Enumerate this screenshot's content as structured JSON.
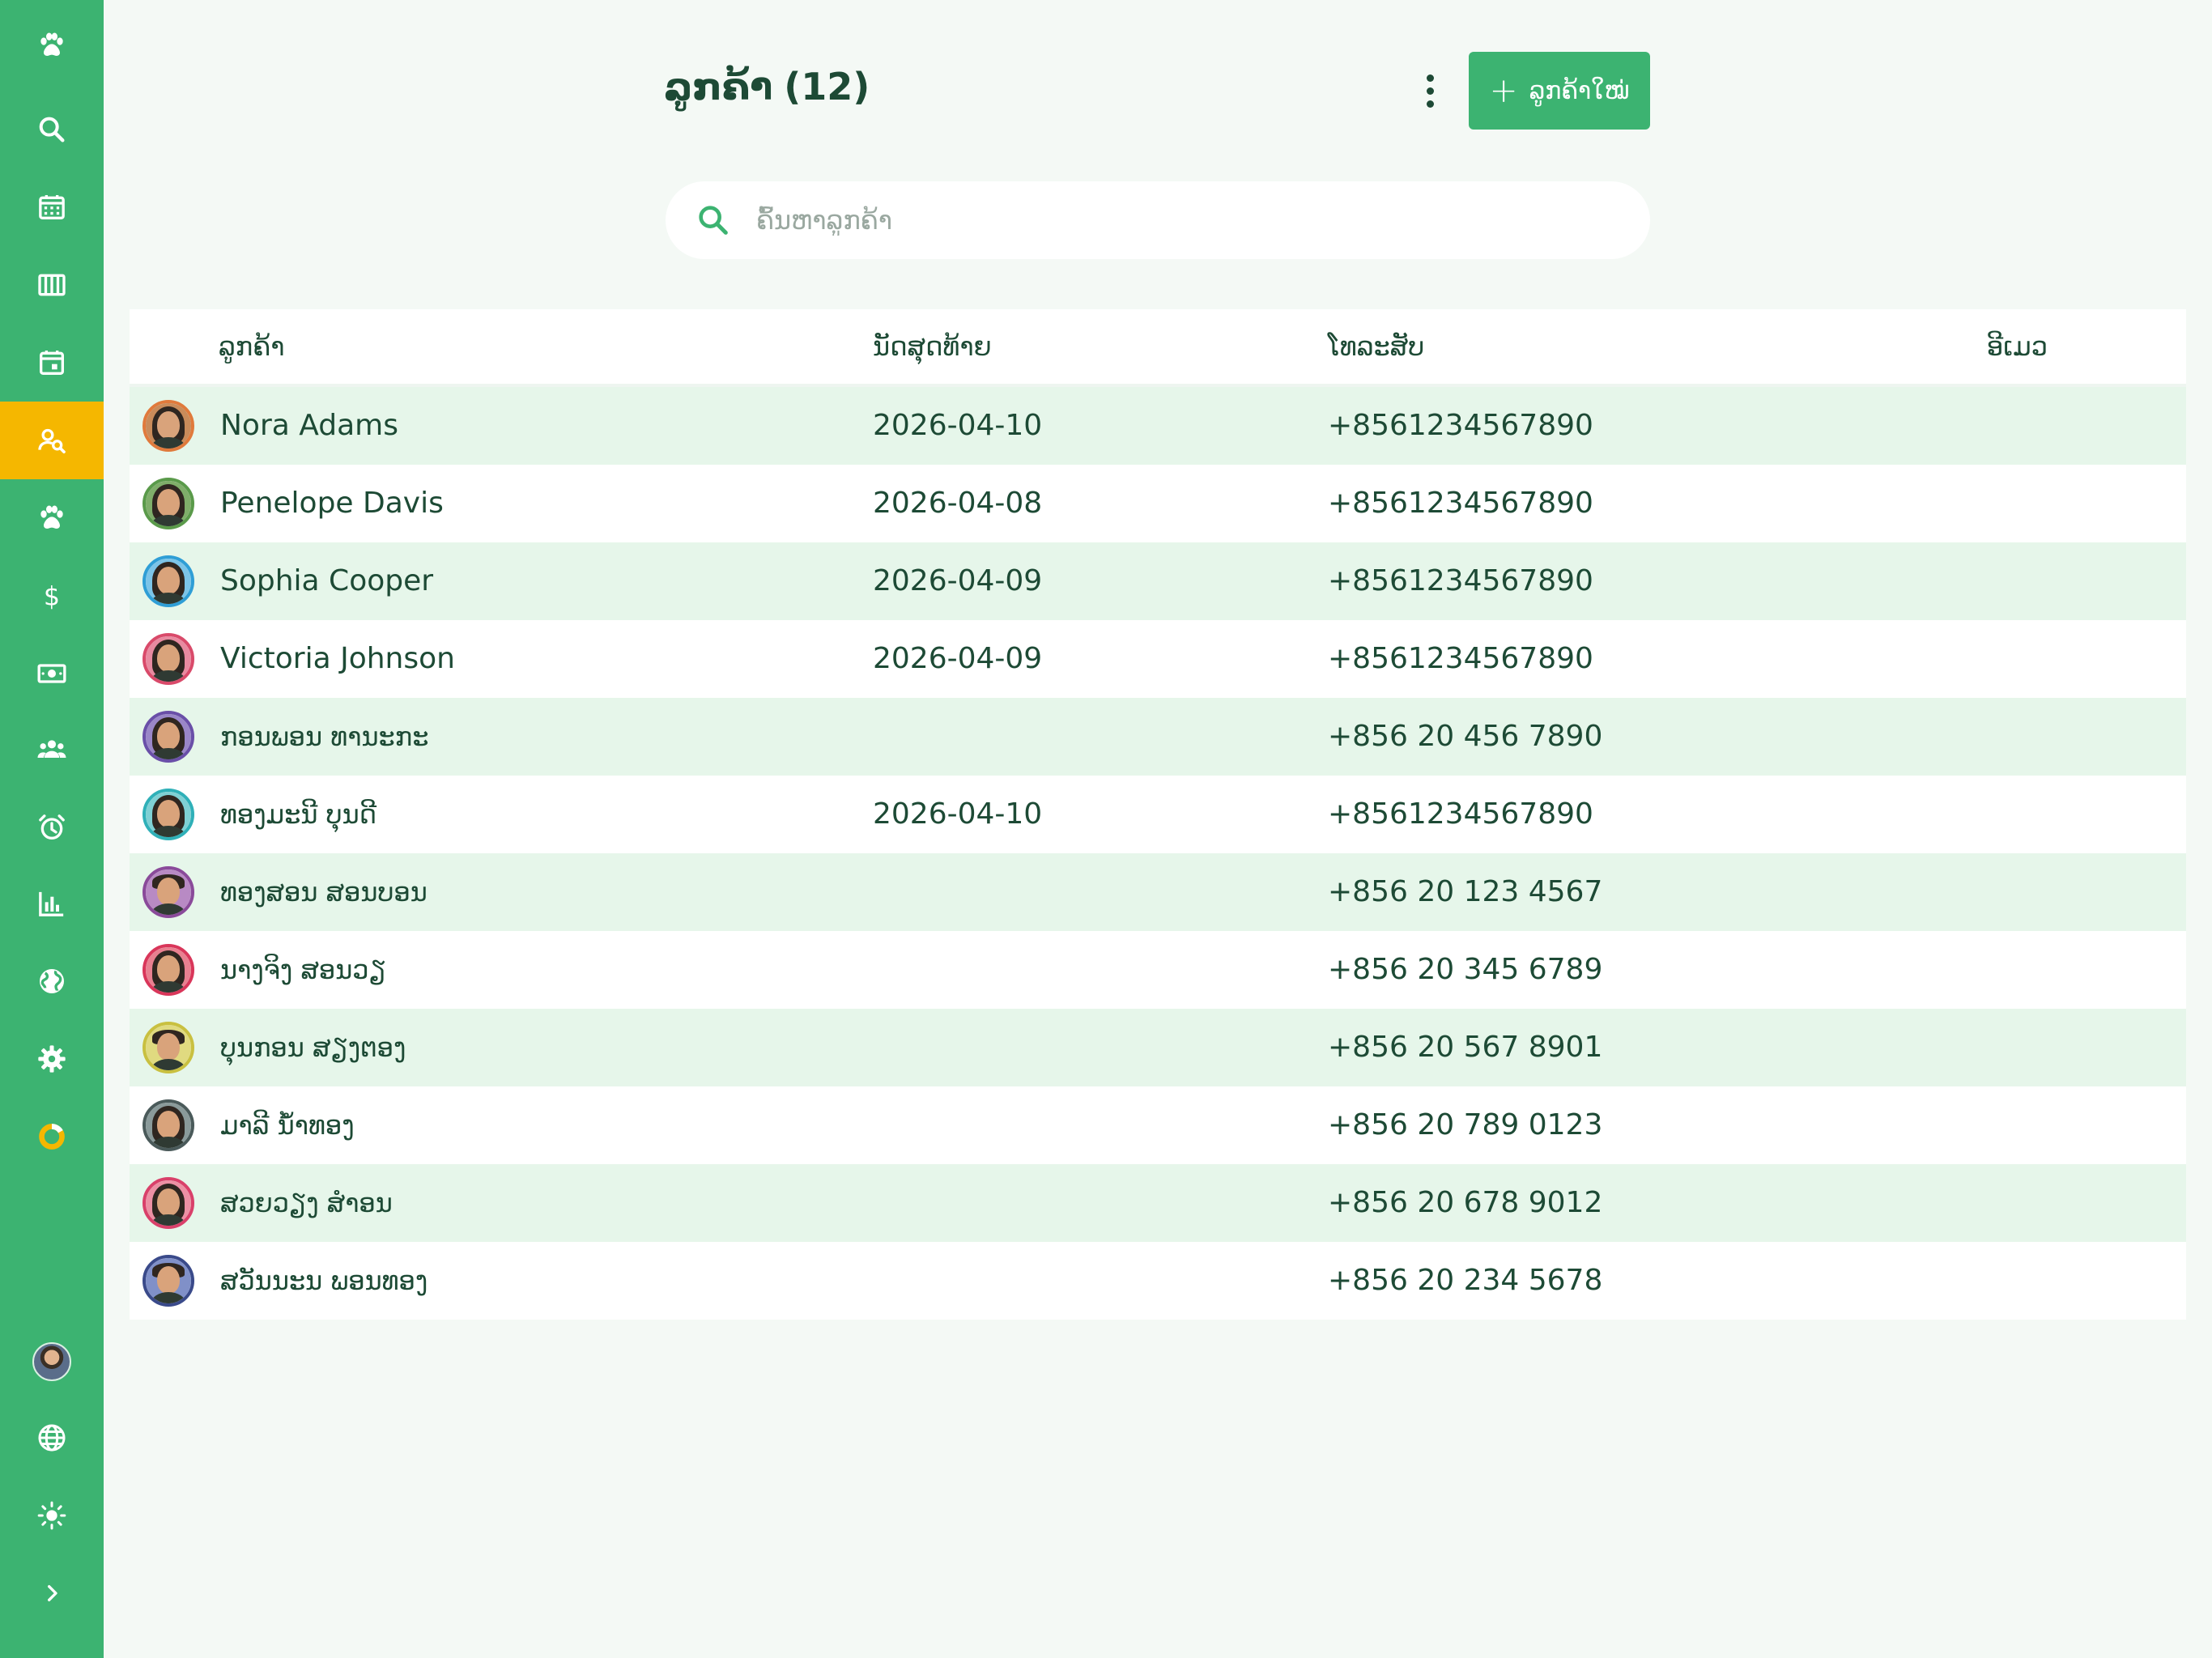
{
  "sidebar": {
    "items": [
      {
        "icon": "paw-icon",
        "active": false
      },
      {
        "icon": "search-icon",
        "active": false
      },
      {
        "icon": "calendar-grid-icon",
        "active": false
      },
      {
        "icon": "columns-icon",
        "active": false
      },
      {
        "icon": "calendar-event-icon",
        "active": false
      },
      {
        "icon": "customer-search-icon",
        "active": true
      },
      {
        "icon": "paw-icon",
        "active": false
      },
      {
        "icon": "dollar-icon",
        "active": false
      },
      {
        "icon": "cash-icon",
        "active": false
      },
      {
        "icon": "group-icon",
        "active": false
      },
      {
        "icon": "alarm-icon",
        "active": false
      },
      {
        "icon": "bar-chart-icon",
        "active": false
      },
      {
        "icon": "globe-filled-icon",
        "active": false
      },
      {
        "icon": "gear-icon",
        "active": false
      },
      {
        "icon": "donut-icon",
        "active": false
      }
    ],
    "bottom": [
      {
        "icon": "user-avatar"
      },
      {
        "icon": "language-globe-icon"
      },
      {
        "icon": "sun-icon"
      },
      {
        "icon": "chevron-right-icon"
      }
    ],
    "colors": {
      "background": "#3cb371",
      "active": "#f5b700"
    }
  },
  "header": {
    "title": "ລູກຄ້າ",
    "count": "(12)",
    "add_button_label": "ລູກຄ້າໃໝ່"
  },
  "search": {
    "placeholder": "ຄົ້ນຫາລູກຄ້າ",
    "value": ""
  },
  "table": {
    "columns": [
      "ລູກຄ້າ",
      "ນັດສຸດທ້າຍ",
      "ໂທລະສັບ",
      "ອີເມວ"
    ],
    "rows": [
      {
        "name": "Nora Adams",
        "last_appointment": "2026-04-10",
        "phone": "+8561234567890",
        "email": "",
        "ring": "#e07a3c",
        "bg": "#c98b5a",
        "gender": "f"
      },
      {
        "name": "Penelope Davis",
        "last_appointment": "2026-04-08",
        "phone": "+8561234567890",
        "email": "",
        "ring": "#5a9a4a",
        "bg": "#7fae6a",
        "gender": "f"
      },
      {
        "name": "Sophia Cooper",
        "last_appointment": "2026-04-09",
        "phone": "+8561234567890",
        "email": "",
        "ring": "#2f9ed6",
        "bg": "#7cc4e8",
        "gender": "f"
      },
      {
        "name": "Victoria Johnson",
        "last_appointment": "2026-04-09",
        "phone": "+8561234567890",
        "email": "",
        "ring": "#d94a6a",
        "bg": "#e88aa0",
        "gender": "f"
      },
      {
        "name": "ກອນພອນ ທານະກະ",
        "last_appointment": "",
        "phone": "+856 20 456 7890",
        "email": "",
        "ring": "#6a4fa8",
        "bg": "#9a86c8",
        "gender": "f"
      },
      {
        "name": "ທອງມະນີ ບຸນດີ",
        "last_appointment": "2026-04-10",
        "phone": "+8561234567890",
        "email": "",
        "ring": "#2fb0b8",
        "bg": "#7fd0d4",
        "gender": "f"
      },
      {
        "name": "ທອງສອນ ສອນບອນ",
        "last_appointment": "",
        "phone": "+856 20 123 4567",
        "email": "",
        "ring": "#8a4a9a",
        "bg": "#b88ac4",
        "gender": "m"
      },
      {
        "name": "ນາງຈິງ ສອນວຽ",
        "last_appointment": "",
        "phone": "+856 20 345 6789",
        "email": "",
        "ring": "#d9365a",
        "bg": "#e88090",
        "gender": "f"
      },
      {
        "name": "ບຸນກອນ ສຽງຕອງ",
        "last_appointment": "",
        "phone": "+856 20 567 8901",
        "email": "",
        "ring": "#c9c040",
        "bg": "#e0da80",
        "gender": "m"
      },
      {
        "name": "ມາລີ ນໍ້າທອງ",
        "last_appointment": "",
        "phone": "+856 20 789 0123",
        "email": "",
        "ring": "#4a5a5a",
        "bg": "#8a9a9a",
        "gender": "f"
      },
      {
        "name": "ສວຍວຽງ ສໍາອນ",
        "last_appointment": "",
        "phone": "+856 20 678 9012",
        "email": "",
        "ring": "#d9406a",
        "bg": "#ec90a4",
        "gender": "f"
      },
      {
        "name": "ສວັນນະນ ພອນທອງ",
        "last_appointment": "",
        "phone": "+856 20 234 5678",
        "email": "",
        "ring": "#3a4a8a",
        "bg": "#8090c8",
        "gender": "m"
      }
    ]
  }
}
